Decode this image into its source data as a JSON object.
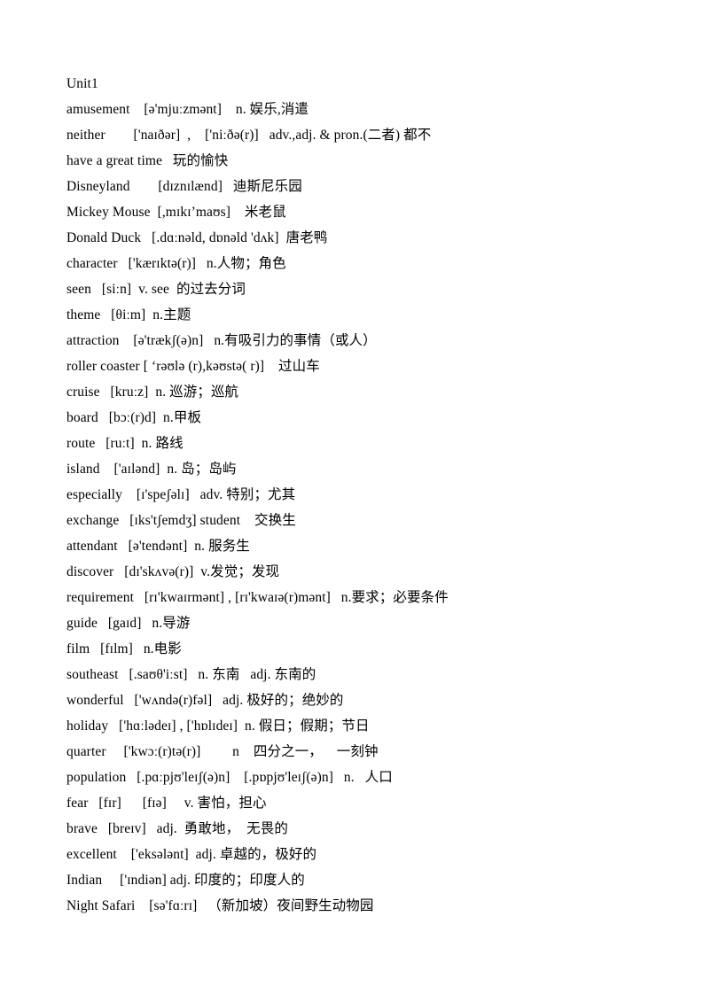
{
  "document": {
    "heading": "Unit1",
    "lines": [
      "amusement    [ə'mjuːzmənt]    n. 娱乐,消遣",
      "neither        ['naɪðər]  ,    ['niːðə(r)]   adv.,adj. & pron.(二者) 都不",
      "have a great time   玩的愉快",
      "Disneyland        [dɪznɪlænd]   迪斯尼乐园",
      "Mickey Mouse  [,mɪkɪ’maʊs]    米老鼠",
      "Donald Duck   [.dɑːnəld, dɒnəld 'dʌk]  唐老鸭",
      "character   ['kærɪktə(r)]   n.人物；角色",
      "seen   [siːn]  v. see  的过去分词",
      "theme   [θiːm]  n.主题",
      "attraction    [ə'trækʃ(ə)n]   n.有吸引力的事情（或人）",
      "roller coaster [ ‘rəʊlə (r),kəʊstə( r)]    过山车",
      "cruise   [kruːz]  n. 巡游；巡航",
      "board   [bɔː(r)d]  n.甲板",
      "route   [ruːt]  n. 路线",
      "island    ['aɪlənd]  n. 岛；岛屿",
      "especially    [ɪ'speʃəlɪ]   adv. 特别；尤其",
      "exchange   [ɪks'tʃemdʒ] student    交换生",
      "attendant   [ə'tendənt]  n. 服务生",
      "discover   [dɪ'skʌvə(r)]  v.发觉；发现",
      "requirement   [rɪ'kwaɪrmənt] , [rɪ'kwaɪə(r)mənt]   n.要求；必要条件",
      "guide   [gaɪd]   n.导游",
      "film   [fɪlm]   n.电影",
      "southeast   [.saʊθ'iːst]   n. 东南   adj. 东南的",
      "wonderful   ['wʌndə(r)fəl]   adj. 极好的；绝妙的",
      "holiday   ['hɑːlədeɪ] , ['hɒlɪdeɪ]  n. 假日；假期；节日",
      "quarter     ['kwɔː(r)tə(r)]         n    四分之一，    一刻钟",
      "population   [.pɑːpjʊ'leɪʃ(ə)n]    [.pɒpjʊ'leɪʃ(ə)n]   n.   人口",
      "fear   [fɪr]      [fɪə]     v. 害怕，担心",
      "brave   [breɪv]   adj.  勇敢地，  无畏的",
      "excellent    ['eksələnt]  adj. 卓越的，极好的",
      "Indian     ['ɪndiən] adj. 印度的；印度人的",
      "Night Safari    [sə'fɑːrɪ]   （新加坡）夜间野生动物园"
    ]
  }
}
